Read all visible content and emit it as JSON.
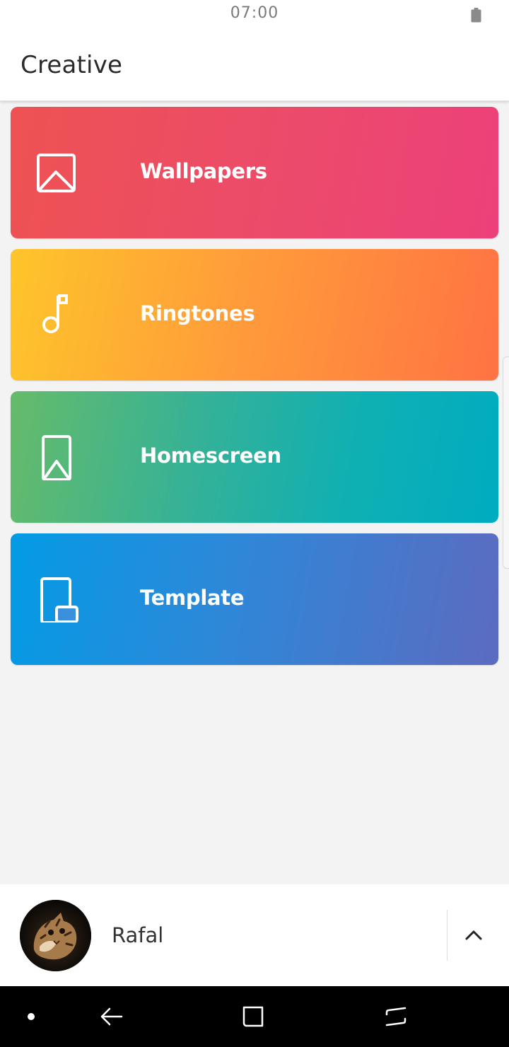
{
  "status_bar": {
    "time": "07:00",
    "battery_icon": "battery-icon"
  },
  "app_bar": {
    "title": "Creative"
  },
  "categories": [
    {
      "label": "Wallpapers",
      "icon": "image-icon",
      "gradient": [
        "#ee5253",
        "#ec407a"
      ]
    },
    {
      "label": "Ringtones",
      "icon": "music-note-icon",
      "gradient": [
        "#fdc32c",
        "#ff7043"
      ]
    },
    {
      "label": "Homescreen",
      "icon": "phone-image-icon",
      "gradient": [
        "#66bb6a",
        "#00acc1"
      ]
    },
    {
      "label": "Template",
      "icon": "template-icon",
      "gradient": [
        "#039be5",
        "#5c6bc0"
      ]
    }
  ],
  "profile": {
    "name": "Rafal",
    "avatar": "cat-avatar",
    "expand_icon": "chevron-up-icon"
  },
  "navigation": {
    "items": [
      "dot-icon",
      "back-icon",
      "recents-icon",
      "switch-icon"
    ]
  }
}
